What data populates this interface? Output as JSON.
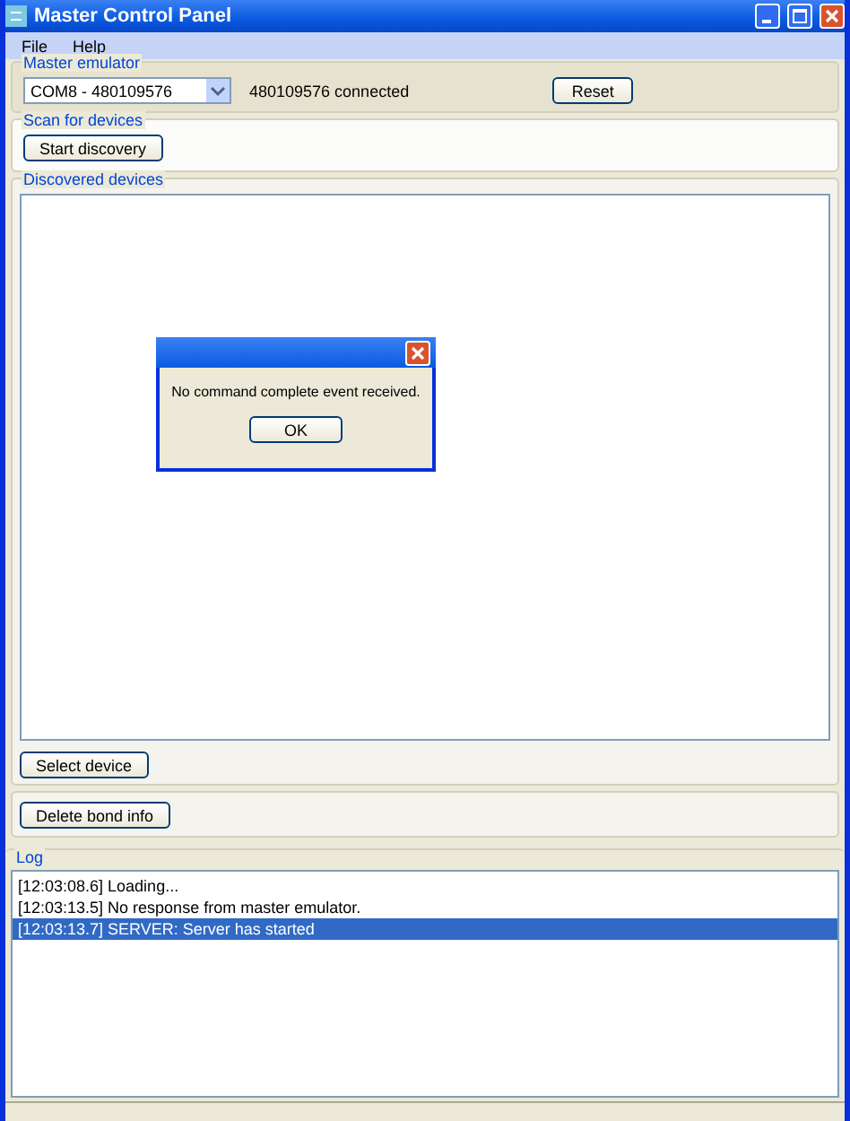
{
  "window": {
    "title": "Master Control Panel"
  },
  "menu": [
    "File",
    "Help"
  ],
  "master_emulator": {
    "label": "Master emulator",
    "port": "COM8 - 480109576",
    "status": "480109576 connected",
    "button": "Reset"
  },
  "scan": {
    "label": "Scan for devices",
    "button": "Start discovery"
  },
  "discovered": {
    "label": "Discovered devices",
    "button": "Select device"
  },
  "bond": {
    "button": "Delete bond info"
  },
  "dialog": {
    "message": "No command complete event received.",
    "button": "OK"
  },
  "log": {
    "label": "Log",
    "entries": [
      {
        "text": "[12:03:08.6] Loading...",
        "selected": false
      },
      {
        "text": "[12:03:13.5] No response from master emulator.",
        "selected": false
      },
      {
        "text": "[12:03:13.7] SERVER: Server has started",
        "selected": true
      }
    ]
  }
}
